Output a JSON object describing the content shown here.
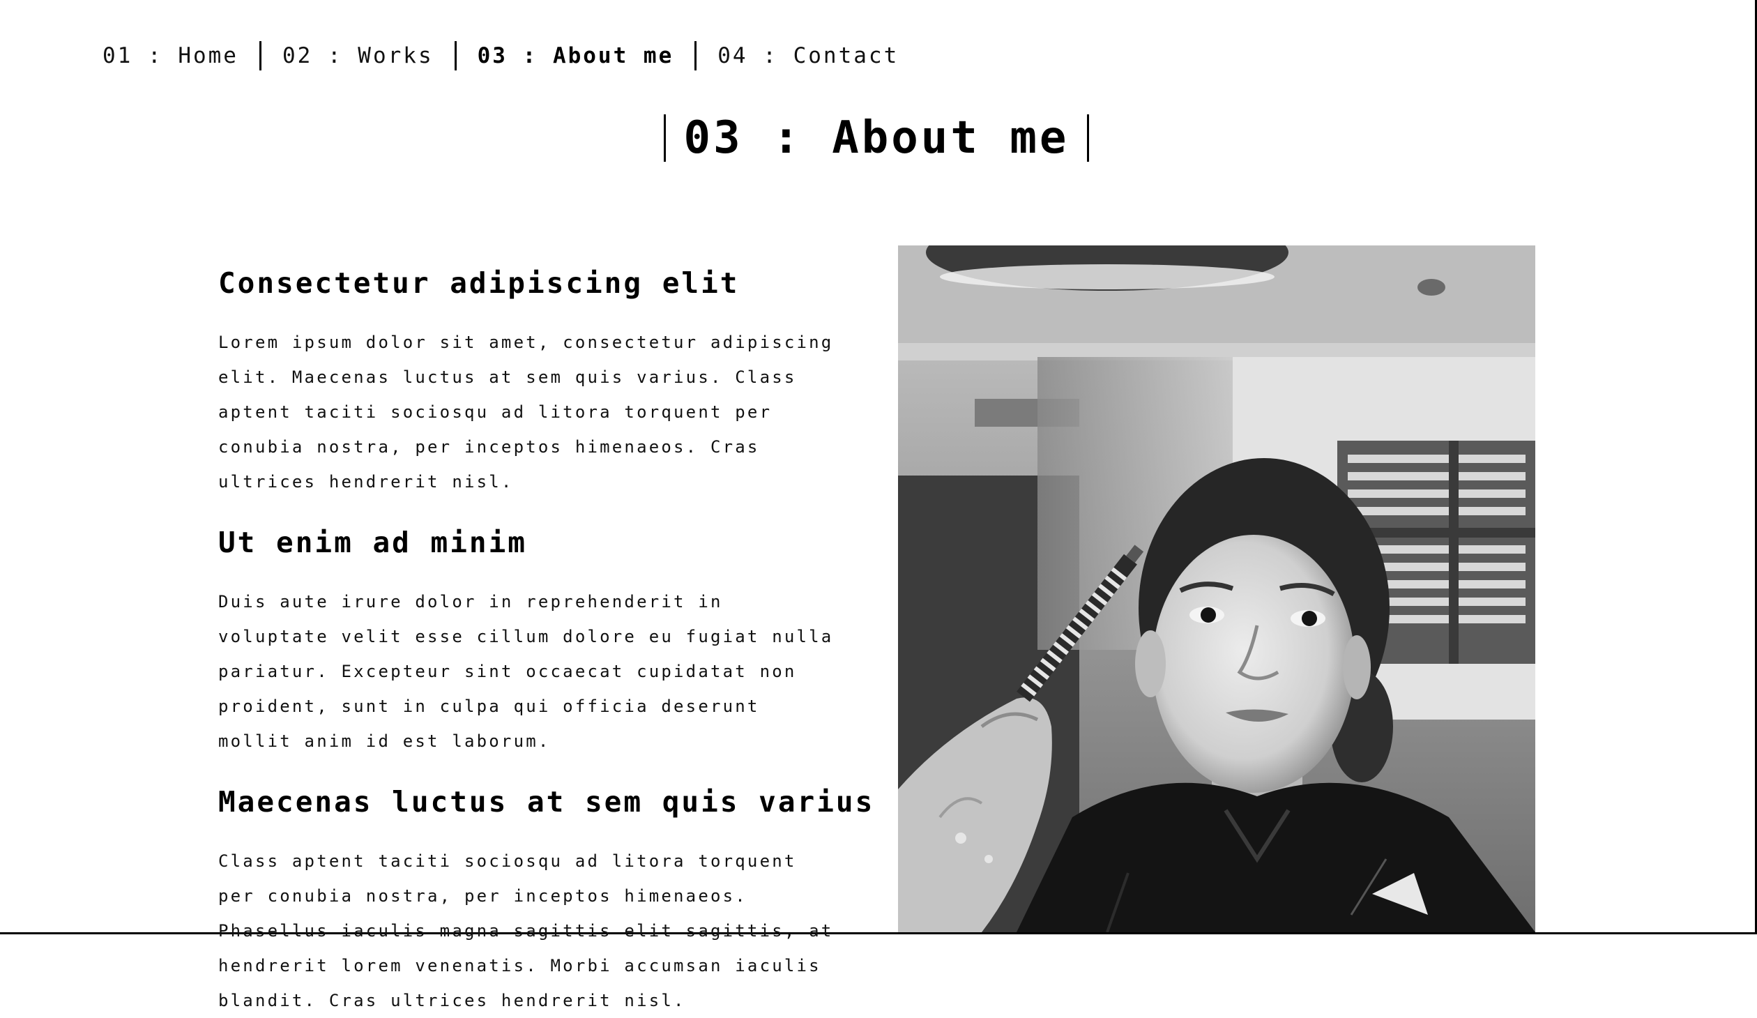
{
  "nav": {
    "items": [
      {
        "label": "01 : Home",
        "active": false
      },
      {
        "label": "02 : Works",
        "active": false
      },
      {
        "label": "03 : About me",
        "active": true
      },
      {
        "label": "04 : Contact",
        "active": false
      }
    ]
  },
  "section": {
    "title": "03 : About me"
  },
  "blocks": [
    {
      "heading": "Consectetur adipiscing elit",
      "text": "Lorem ipsum dolor sit amet, consectetur adipiscing elit. Maecenas luctus at sem quis varius. Class aptent taciti sociosqu ad litora torquent per conubia nostra, per inceptos himenaeos. Cras ultrices hendrerit nisl."
    },
    {
      "heading": "Ut enim ad minim",
      "text": "Duis aute irure dolor in reprehenderit in voluptate velit esse cillum dolore eu fugiat nulla pariatur. Excepteur sint occaecat cupidatat non proident, sunt in culpa qui officia deserunt mollit anim id est laborum."
    },
    {
      "heading": "Maecenas luctus at sem quis varius",
      "text": "Class aptent taciti sociosqu ad litora torquent per conubia nostra, per inceptos himenaeos. Phasellus iaculis magna sagittis elit sagittis, at hendrerit lorem venenatis. Morbi accumsan iaculis blandit. Cras ultrices hendrerit nisl."
    }
  ],
  "photo": {
    "style": "black-and-white portrait"
  },
  "colors": {
    "background": "#ffffff",
    "text": "#000000"
  }
}
